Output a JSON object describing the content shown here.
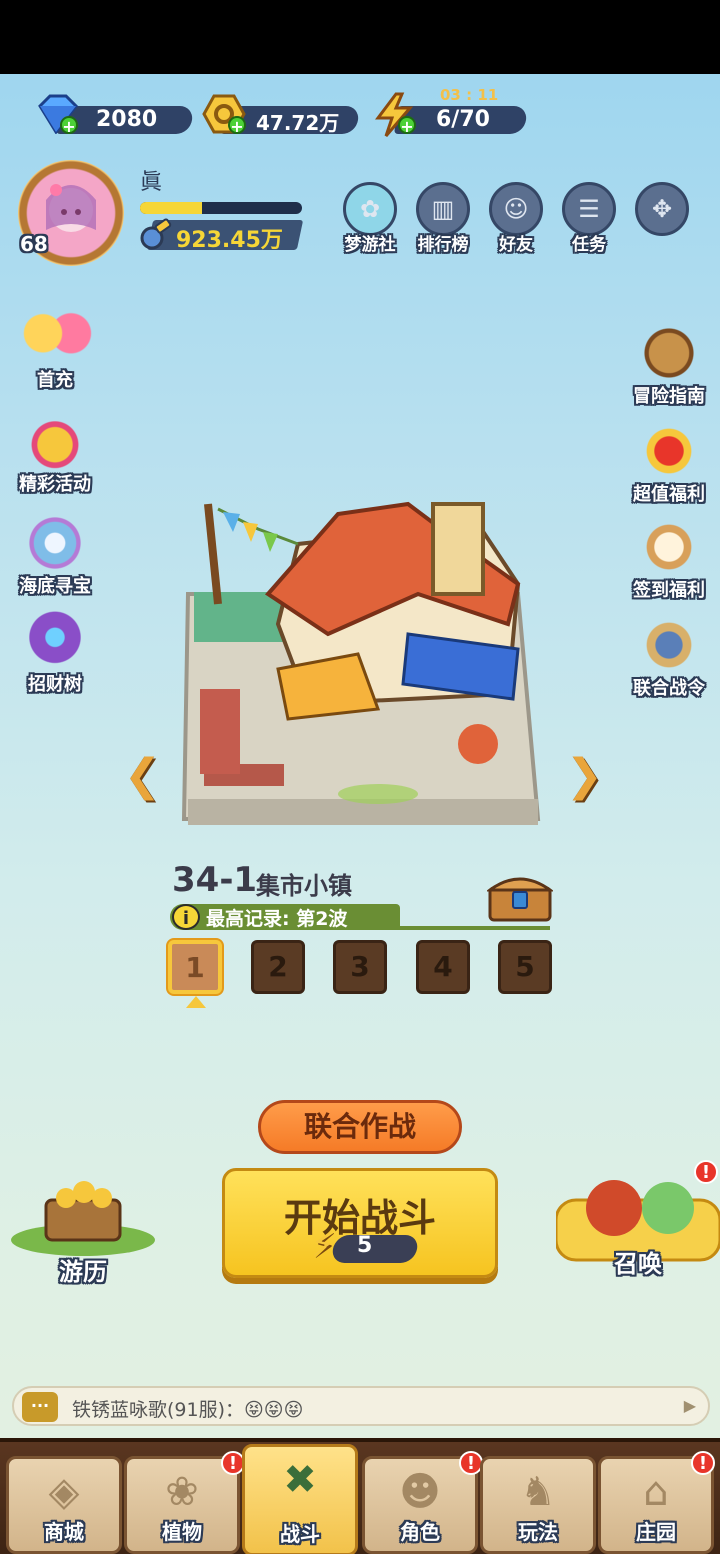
{
  "resources": {
    "gems": "2080",
    "coins": "47.72万",
    "energy": "6/70",
    "energy_timer": "03 : 11"
  },
  "profile": {
    "name": "眞",
    "level": "68",
    "exp_fraction": 0.38,
    "power": "923.45万"
  },
  "top_menu": [
    {
      "label": "梦游社",
      "icon": "dream-club-icon"
    },
    {
      "label": "排行榜",
      "icon": "ranking-icon"
    },
    {
      "label": "好友",
      "icon": "friends-icon"
    },
    {
      "label": "任务",
      "icon": "tasks-icon"
    },
    {
      "label": "",
      "icon": "more-icon"
    }
  ],
  "left_menu": [
    {
      "label": "首充"
    },
    {
      "label": "精彩活动"
    },
    {
      "label": "海底寻宝"
    },
    {
      "label": "招财树"
    }
  ],
  "right_menu": [
    {
      "label": "冒险指南"
    },
    {
      "label": "超值福利"
    },
    {
      "label": "签到福利"
    },
    {
      "label": "联合战令"
    }
  ],
  "stage": {
    "id": "34-1",
    "name": "集市小镇",
    "record": "最高记录: 第2波",
    "waves": [
      "1",
      "2",
      "3",
      "4",
      "5"
    ],
    "active_wave": "1"
  },
  "buttons": {
    "coop": "联合作战",
    "start": "开始战斗",
    "start_cost": "5",
    "travel": "游历",
    "summon": "召唤"
  },
  "chat": {
    "message": "铁锈蓝咏歌(91服)：😝😝😝"
  },
  "nav": [
    {
      "label": "商城",
      "badge": false
    },
    {
      "label": "植物",
      "badge": true
    },
    {
      "label": "战斗",
      "badge": false,
      "active": true
    },
    {
      "label": "角色",
      "badge": true
    },
    {
      "label": "玩法",
      "badge": false
    },
    {
      "label": "庄园",
      "badge": true
    }
  ],
  "colors": {
    "accent_yellow": "#f6c73c",
    "orange_button": "#f57b27",
    "nav_brown": "#5a3620",
    "badge_red": "#e8352a"
  }
}
